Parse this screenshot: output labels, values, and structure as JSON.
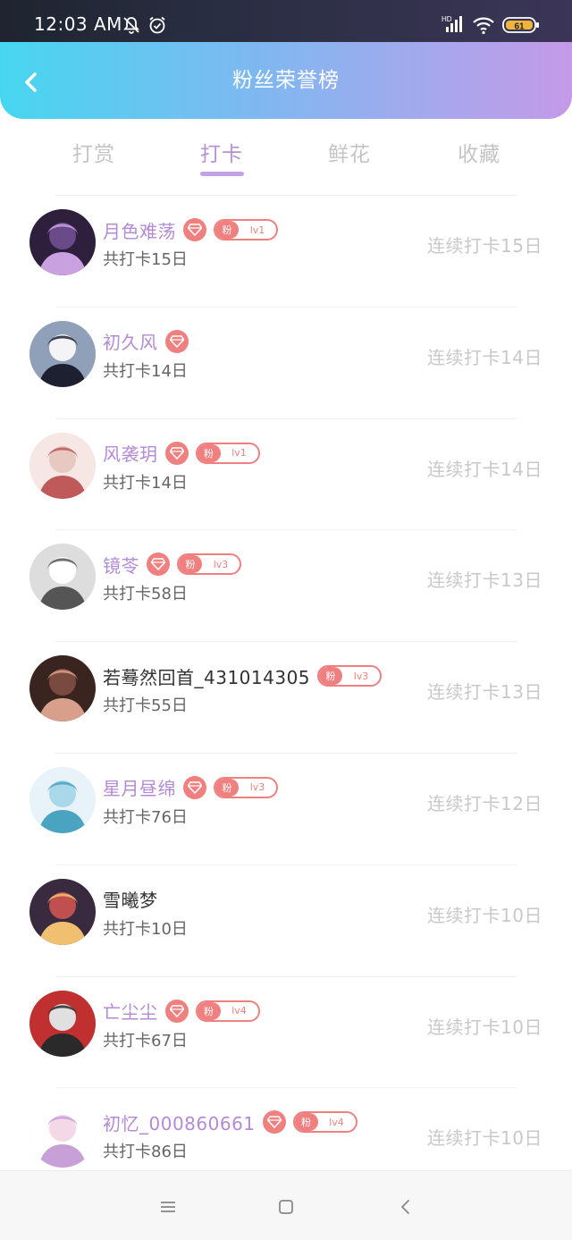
{
  "status_bar": {
    "time": "12:03 AM",
    "icons": [
      "bell-off-icon",
      "alarm-icon",
      "signal-icon",
      "wifi-icon",
      "battery-icon"
    ],
    "network_label": "HD",
    "battery": "61"
  },
  "header": {
    "back_icon": "chevron-left-icon",
    "title": "粉丝荣誉榜",
    "gradient": [
      "#47d6f0",
      "#c49ae9"
    ]
  },
  "tabs": [
    {
      "label": "打赏",
      "active": false
    },
    {
      "label": "打卡",
      "active": true
    },
    {
      "label": "鲜花",
      "active": false
    },
    {
      "label": "收藏",
      "active": false
    }
  ],
  "colors": {
    "accent_purple": "#b48ad6",
    "badge_red": "#f08080",
    "muted_text": "#c8c8c8"
  },
  "fans": [
    {
      "name": "月色难荡",
      "vip": true,
      "fan_tag": "粉",
      "level": "lv1",
      "total": "共打卡15日",
      "streak": "连续打卡15日",
      "highlight": true
    },
    {
      "name": "初久风",
      "vip": true,
      "fan_tag": "",
      "level": "",
      "total": "共打卡14日",
      "streak": "连续打卡14日",
      "highlight": true
    },
    {
      "name": "风袭玥",
      "vip": true,
      "fan_tag": "粉",
      "level": "lv1",
      "total": "共打卡14日",
      "streak": "连续打卡14日",
      "highlight": true
    },
    {
      "name": "镜苓",
      "vip": true,
      "fan_tag": "粉",
      "level": "lv3",
      "total": "共打卡58日",
      "streak": "连续打卡13日",
      "highlight": true
    },
    {
      "name": "若蓦然回首_431014305",
      "vip": false,
      "fan_tag": "粉",
      "level": "lv3",
      "total": "共打卡55日",
      "streak": "连续打卡13日",
      "highlight": false
    },
    {
      "name": "星月昼绵",
      "vip": true,
      "fan_tag": "粉",
      "level": "lv3",
      "total": "共打卡76日",
      "streak": "连续打卡12日",
      "highlight": true
    },
    {
      "name": "雪曦梦",
      "vip": false,
      "fan_tag": "",
      "level": "",
      "total": "共打卡10日",
      "streak": "连续打卡10日",
      "highlight": false
    },
    {
      "name": "亡尘尘",
      "vip": true,
      "fan_tag": "粉",
      "level": "lv4",
      "total": "共打卡67日",
      "streak": "连续打卡10日",
      "highlight": true
    },
    {
      "name": "初忆_000860661",
      "vip": true,
      "fan_tag": "粉",
      "level": "lv4",
      "total": "共打卡86日",
      "streak": "连续打卡10日",
      "highlight": true
    }
  ],
  "nav_bar": {
    "icons": [
      "menu-icon",
      "home-icon",
      "back-icon"
    ]
  }
}
